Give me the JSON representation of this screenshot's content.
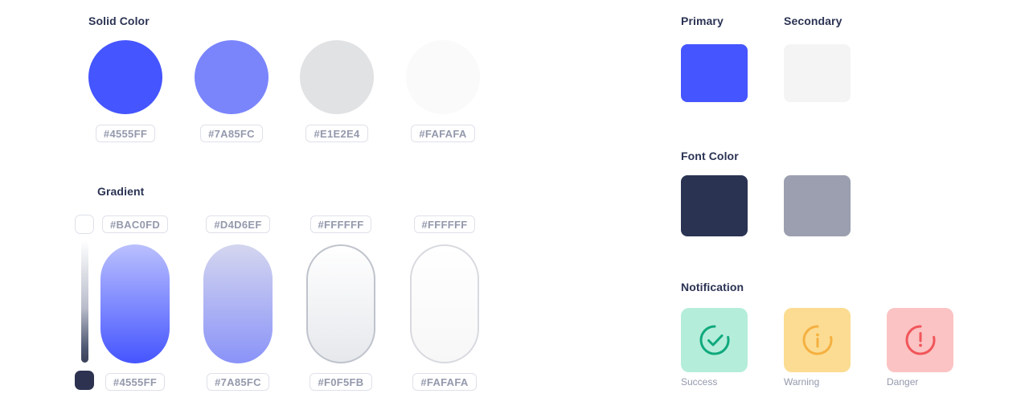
{
  "solid_color": {
    "title": "Solid Color",
    "swatches": [
      {
        "hex": "#4555FF",
        "label": "#4555FF",
        "name": "solid-swatch-primary-blue"
      },
      {
        "hex": "#7A85FC",
        "label": "#7A85FC",
        "name": "solid-swatch-light-blue"
      },
      {
        "hex": "#E1E2E4",
        "label": "#E1E2E4",
        "name": "solid-swatch-gray"
      },
      {
        "hex": "#FAFAFA",
        "label": "#FAFAFA",
        "name": "solid-swatch-offwhite"
      }
    ]
  },
  "gradient": {
    "title": "Gradient",
    "slider": {
      "top_swatch_hex": "#FFFFFF",
      "bottom_swatch_hex": "#2D3250"
    },
    "swatches": [
      {
        "top_label": "#BAC0FD",
        "bottom_label": "#4555FF",
        "from": "#BAC0FD",
        "to": "#4555FF",
        "border": "none"
      },
      {
        "top_label": "#D4D6EF",
        "bottom_label": "#7A85FC",
        "from": "#D4D6EF",
        "to": "#8A93F8",
        "border": "none"
      },
      {
        "top_label": "#FFFFFF",
        "bottom_label": "#F0F5FB",
        "from": "#FFFFFF",
        "to": "#E6E8EC",
        "border": "#BFC3CC"
      },
      {
        "top_label": "#FFFFFF",
        "bottom_label": "#FAFAFA",
        "from": "#FFFFFF",
        "to": "#F7F7F8",
        "border": "#D8DAE0"
      }
    ]
  },
  "primary": {
    "title": "Primary",
    "hex": "#4555FF"
  },
  "secondary": {
    "title": "Secondary",
    "hex": "#F4F4F4"
  },
  "font_color": {
    "title": "Font Color",
    "swatches": [
      {
        "hex": "#2B3353",
        "name": "font-color-dark"
      },
      {
        "hex": "#9B9FAF",
        "name": "font-color-gray"
      }
    ]
  },
  "notification": {
    "title": "Notification",
    "items": [
      {
        "label": "Success",
        "bg": "#B5EDDB",
        "icon_color": "#0FA97C",
        "icon": "check-circle-icon",
        "glyph": "check"
      },
      {
        "label": "Warning",
        "bg": "#FBDC92",
        "icon_color": "#F5B041",
        "icon": "info-circle-icon",
        "glyph": "i"
      },
      {
        "label": "Danger",
        "bg": "#FBC3C3",
        "icon_color": "#F1555A",
        "icon": "alert-circle-icon",
        "glyph": "!"
      }
    ]
  }
}
